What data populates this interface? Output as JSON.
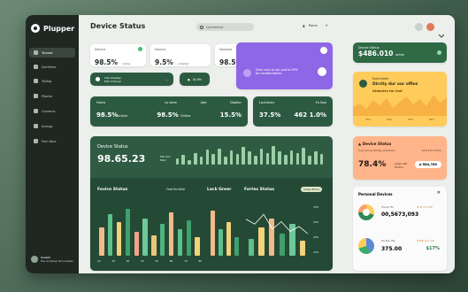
{
  "app": {
    "name": "Plupper"
  },
  "sidebar": {
    "items": [
      {
        "label": "Tsmost"
      },
      {
        "label": "Dorfintes"
      },
      {
        "label": "Tsdlog"
      },
      {
        "label": "Pijonts"
      },
      {
        "label": "Conloms"
      },
      {
        "label": "Amngs"
      },
      {
        "label": "Fom Kors"
      }
    ],
    "user": {
      "name": "Aosbit",
      "sub": "Des sonteap fam loesles"
    }
  },
  "header": {
    "title": "Device Status",
    "search_placeholder": "Quirtetend",
    "menu_label": "Pome"
  },
  "kpis": [
    {
      "label": "Device",
      "value": "98.5%",
      "unit": "online"
    },
    {
      "label": "Device",
      "value": "9.5%",
      "unit": "onfeded"
    },
    {
      "label": "Devines",
      "value": "98.5%",
      "unit": "online"
    }
  ],
  "promo": {
    "text1": "Deer near to we pad to 99%",
    "text2": "be heridteritation"
  },
  "pill": {
    "line1": "Uda Alusdey",
    "line2": "Rdk Il 5unoe",
    "btn": "So Wn"
  },
  "stat_row": {
    "title": "Homs",
    "sub": "Lo dece",
    "a": "98.5%",
    "a_unit": "online",
    "b_label": "Ade",
    "b": "98.5%",
    "b_unit": "Onilna",
    "c_label": "Dlodlor",
    "c": "15.5%",
    "d_label": "Lactdvins",
    "d": "37.5%",
    "e_label": "Fo ltpe",
    "e": "462 1.0%"
  },
  "big": {
    "title": "Device Status",
    "value": "98.65.23",
    "unit1": "Fsd dos",
    "unit2": "Polin",
    "sec1": "Fovice Status",
    "sec1_sub": "Fmd fro lirkle",
    "sec2": "Lack Greer",
    "sec3": "Fortes Status",
    "sec3_btn": "Sdapl Billion",
    "x_labels": [
      "10",
      "20",
      "30",
      "40",
      "50",
      "60",
      "70",
      "80"
    ],
    "y_labels": [
      "30%",
      "20%",
      "40%",
      "10%"
    ],
    "spark": [
      12,
      18,
      9,
      22,
      15,
      28,
      20,
      30,
      14,
      26,
      19,
      33,
      24,
      16,
      29,
      21,
      35,
      25,
      18,
      27,
      22,
      31,
      17,
      24,
      20
    ],
    "bars1": [
      {
        "v": 30,
        "c": "#f2b98a"
      },
      {
        "v": 44,
        "c": "#5fc08a"
      },
      {
        "v": 36,
        "c": "#f4d17c"
      },
      {
        "v": 50,
        "c": "#3fa06c"
      },
      {
        "v": 26,
        "c": "#f2a48a"
      },
      {
        "v": 40,
        "c": "#6ec89a"
      },
      {
        "v": 22,
        "c": "#e8c77a"
      },
      {
        "v": 34,
        "c": "#4fb37e"
      },
      {
        "v": 46,
        "c": "#f2b98a"
      },
      {
        "v": 28,
        "c": "#5fc08a"
      },
      {
        "v": 38,
        "c": "#3fa06c"
      },
      {
        "v": 20,
        "c": "#f4d17c"
      }
    ],
    "bars2": [
      {
        "v": 48,
        "c": "#f2b98a"
      },
      {
        "v": 28,
        "c": "#5fc08a"
      },
      {
        "v": 36,
        "c": "#f4d17c"
      },
      {
        "v": 20,
        "c": "#3fa06c"
      }
    ],
    "bars3": [
      {
        "v": 18,
        "c": "#5fc08a"
      },
      {
        "v": 30,
        "c": "#f4d17c"
      },
      {
        "v": 40,
        "c": "#f2b98a"
      },
      {
        "v": 24,
        "c": "#3fa06c"
      },
      {
        "v": 34,
        "c": "#6ec89a"
      },
      {
        "v": 16,
        "c": "#f4d17c"
      }
    ],
    "line": [
      30,
      26,
      34,
      22,
      28,
      20,
      24,
      18
    ]
  },
  "right": {
    "status": {
      "title": "Device Status",
      "value": "$486.010",
      "unit": "online"
    },
    "alert": {
      "title": "Kubcrtefeh",
      "body": "Dirctly dur our offios",
      "link": "Atlamies for loof",
      "labels": [
        "15%",
        "25%",
        "15%",
        "35%"
      ],
      "wave": [
        10,
        14,
        8,
        18,
        12,
        20,
        9,
        16,
        22,
        13,
        19,
        11,
        24,
        15,
        21
      ]
    },
    "mid": {
      "title": "Device Status",
      "sub": "Inop ening shtogy slolaction",
      "tag": "$18.270 mkt/n",
      "value": "78.4%",
      "v_sub": "Juzah AtP Ortlins",
      "btn": "$-584,760"
    },
    "list": {
      "title": "Personal Devices",
      "items": [
        {
          "name": "Forcer fin",
          "value": "00,5673,093",
          "tag": "★ ★ 1·% 65"
        },
        {
          "name": "Pcrtes ofly",
          "value": "375.00",
          "tag": "★★★ 4·% 45",
          "pct": "$17%"
        }
      ]
    }
  },
  "colors": {
    "green": "#2c5a40",
    "purple": "#8d67e6",
    "orange": "#ffcc5c",
    "peach": "#ffb48a"
  }
}
